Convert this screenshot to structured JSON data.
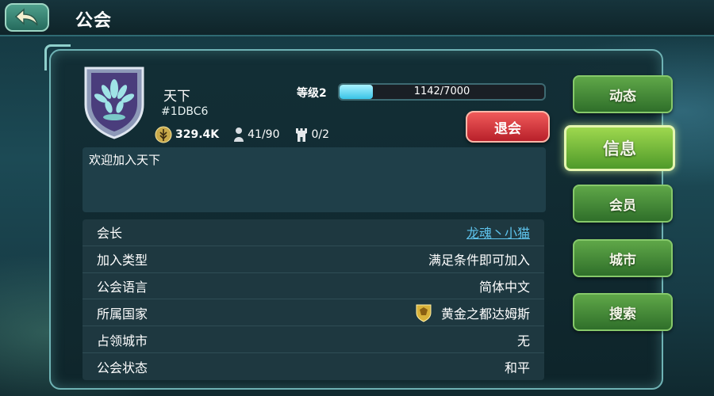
{
  "header": {
    "title": "公会"
  },
  "guild": {
    "name": "天下",
    "id": "#1DBC6",
    "power": "329.4K",
    "members": "41/90",
    "cities": "0/2",
    "level_label": "等级2",
    "level_progress_text": "1142/7000",
    "level_progress": 0.163,
    "quit_label": "退会",
    "announcement": "欢迎加入天下"
  },
  "info_rows": [
    {
      "label": "会长",
      "value": "龙魂丶小猫"
    },
    {
      "label": "加入类型",
      "value": "满足条件即可加入"
    },
    {
      "label": "公会语言",
      "value": "简体中文"
    },
    {
      "label": "所属国家",
      "value": "黄金之都达姆斯"
    },
    {
      "label": "占领城市",
      "value": "无"
    },
    {
      "label": "公会状态",
      "value": "和平"
    }
  ],
  "tabs": [
    {
      "label": "动态"
    },
    {
      "label": "信息"
    },
    {
      "label": "会员"
    },
    {
      "label": "城市"
    },
    {
      "label": "搜索"
    }
  ],
  "active_tab": "信息",
  "colors": {
    "leader_link": "#5ec3ec",
    "quit_button": "#d8303a",
    "tab_green": "#4f9a3a",
    "level_fill": "#39c3e6"
  },
  "icons": {
    "back": "back-arrow-icon",
    "power": "wheat-power-icon",
    "members": "person-icon",
    "cities": "tower-icon",
    "nation": "golden-shield-icon"
  }
}
